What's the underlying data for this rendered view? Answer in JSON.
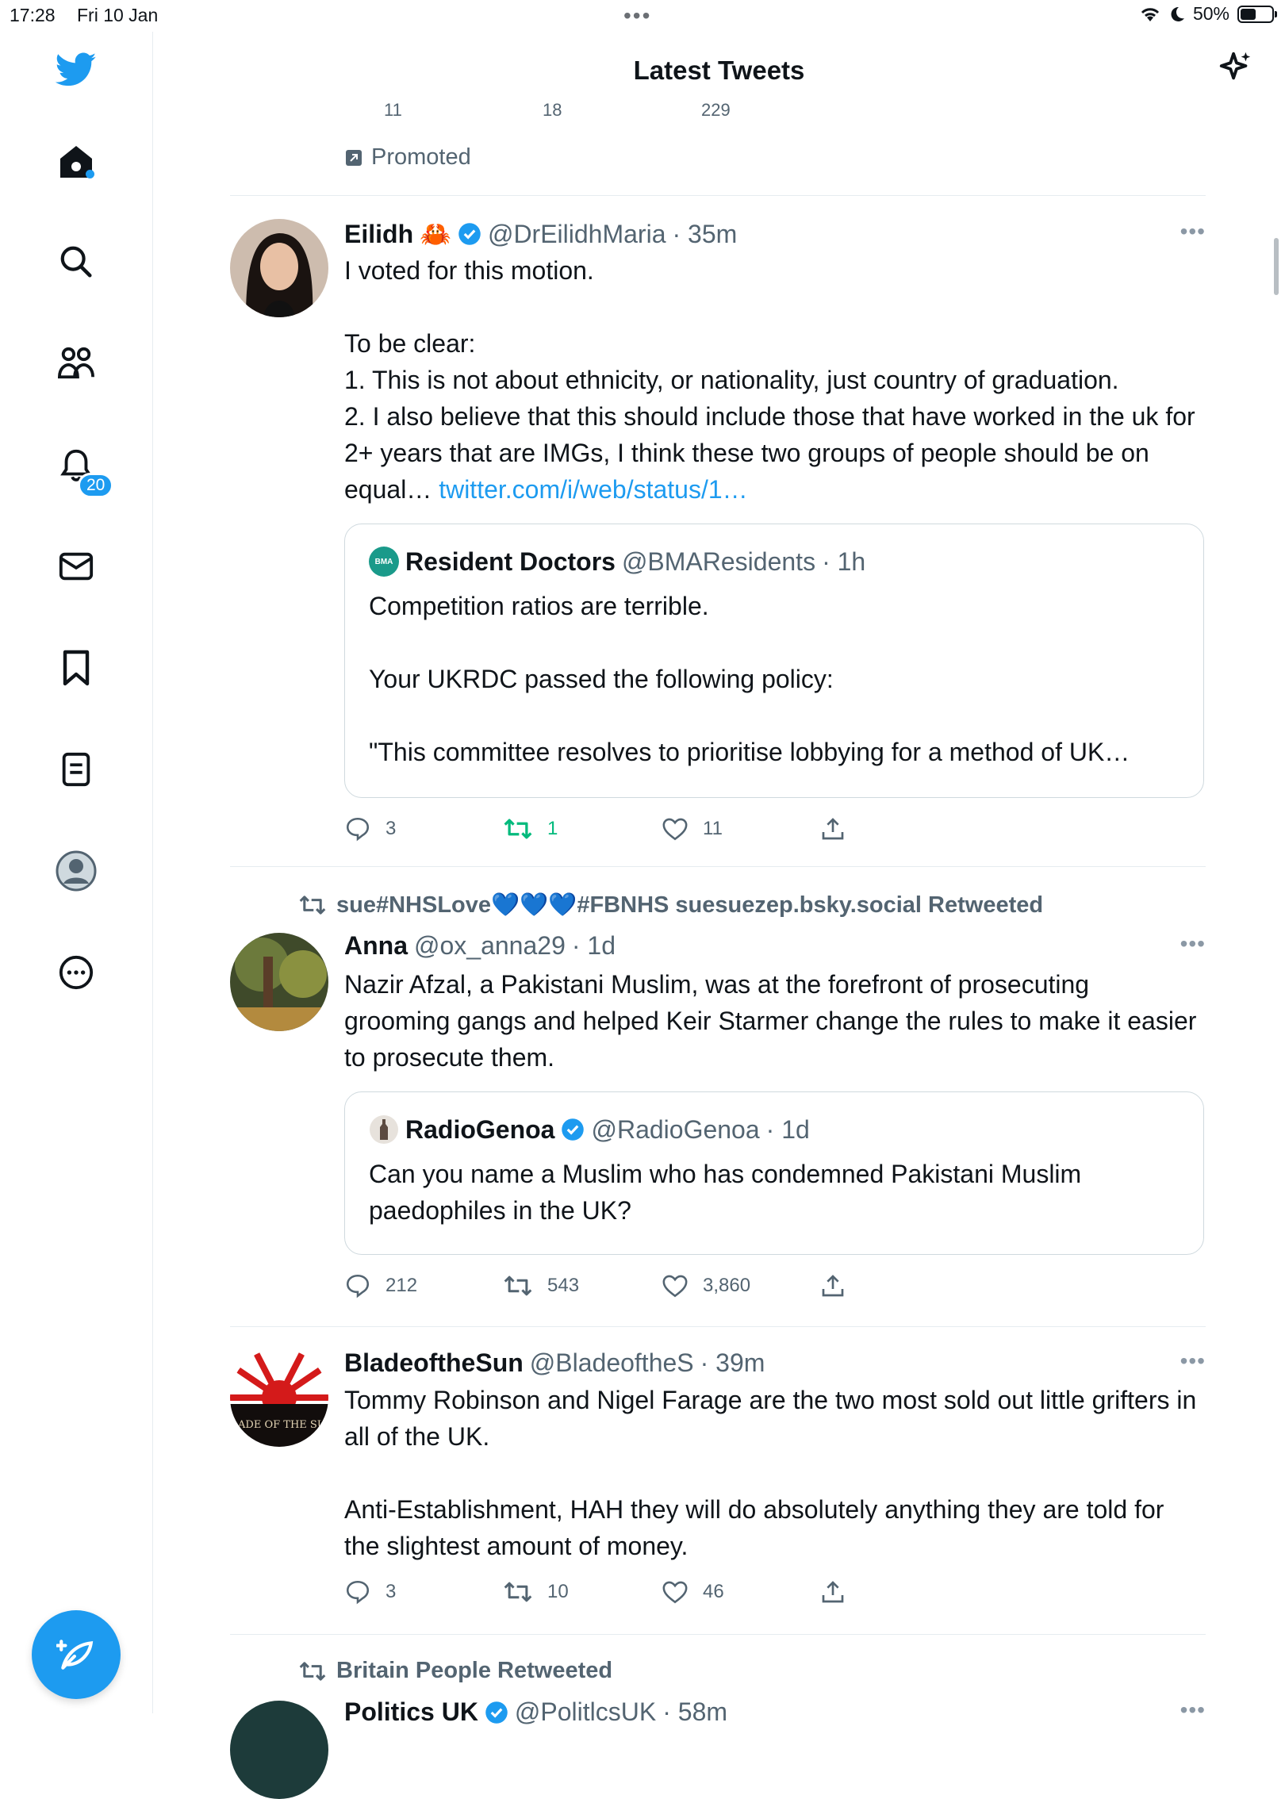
{
  "status_bar": {
    "time": "17:28",
    "date": "Fri 10 Jan",
    "battery": "50%",
    "battery_level": 0.5
  },
  "header": {
    "title": "Latest Tweets"
  },
  "sidebar": {
    "notifications_badge": "20"
  },
  "previous_tweet": {
    "replies": "11",
    "retweets": "18",
    "likes": "229",
    "promoted_label": "Promoted"
  },
  "tweets": [
    {
      "name": "Eilidh",
      "emoji": "🦀",
      "handle": "@DrEilidhMaria",
      "time": "· 35m",
      "text": "I voted for this motion.\n\nTo be clear:\n1. This is not about ethnicity, or nationality, just country of graduation.\n2. I also believe that this should include those that have worked in the uk for 2+ years that are IMGs, I think these two groups of people should be on equal…",
      "link": "twitter.com/i/web/status/1…",
      "quote": {
        "name": "Resident Doctors",
        "handle": "@BMAResidents",
        "time": "· 1h",
        "avatar_text": "BMA",
        "text": "Competition ratios are terrible.\n\nYour UKRDC passed the following policy:\n\n\"This committee resolves to prioritise lobbying for a method of UK…"
      },
      "replies": "3",
      "retweets": "1",
      "likes": "11"
    },
    {
      "retweeted_by": "sue#NHSLove💙💙💙#FBNHS suesuezep.bsky.social Retweeted",
      "name": "Anna",
      "handle": "@ox_anna29",
      "time": "· 1d",
      "text": "Nazir Afzal, a Pakistani Muslim, was at the forefront of prosecuting grooming gangs and helped Keir Starmer change the rules to make it easier to prosecute them.",
      "quote": {
        "name": "RadioGenoa",
        "handle": "@RadioGenoa",
        "time": "· 1d",
        "text": "Can you name a Muslim who has condemned Pakistani Muslim paedophiles in the UK?"
      },
      "replies": "212",
      "retweets": "543",
      "likes": "3,860"
    },
    {
      "name": "BladeoftheSun",
      "handle": "@BladeoftheS",
      "time": "· 39m",
      "avatar_text": "BLADE OF THE SUN",
      "text": "Tommy Robinson and Nigel Farage are the two most sold out little grifters in all of the UK.\n\nAnti-Establishment, HAH they will do absolutely anything they are told for the slightest amount of money.",
      "replies": "3",
      "retweets": "10",
      "likes": "46"
    },
    {
      "retweeted_by": "Britain People Retweeted",
      "name": "Politics UK",
      "handle": "@PolitlcsUK",
      "time": "· 58m"
    }
  ],
  "colors": {
    "accent": "#1d9bf0",
    "retweet_active": "#00ba7c",
    "secondary_text": "#536471"
  },
  "icons": [
    "twitter-bird-icon",
    "home-icon",
    "search-icon",
    "communities-icon",
    "notifications-icon",
    "messages-icon",
    "bookmarks-icon",
    "lists-icon",
    "profile-icon",
    "more-icon",
    "compose-icon",
    "sparkle-icon",
    "reply-icon",
    "retweet-icon",
    "like-icon",
    "share-icon",
    "verified-icon"
  ]
}
